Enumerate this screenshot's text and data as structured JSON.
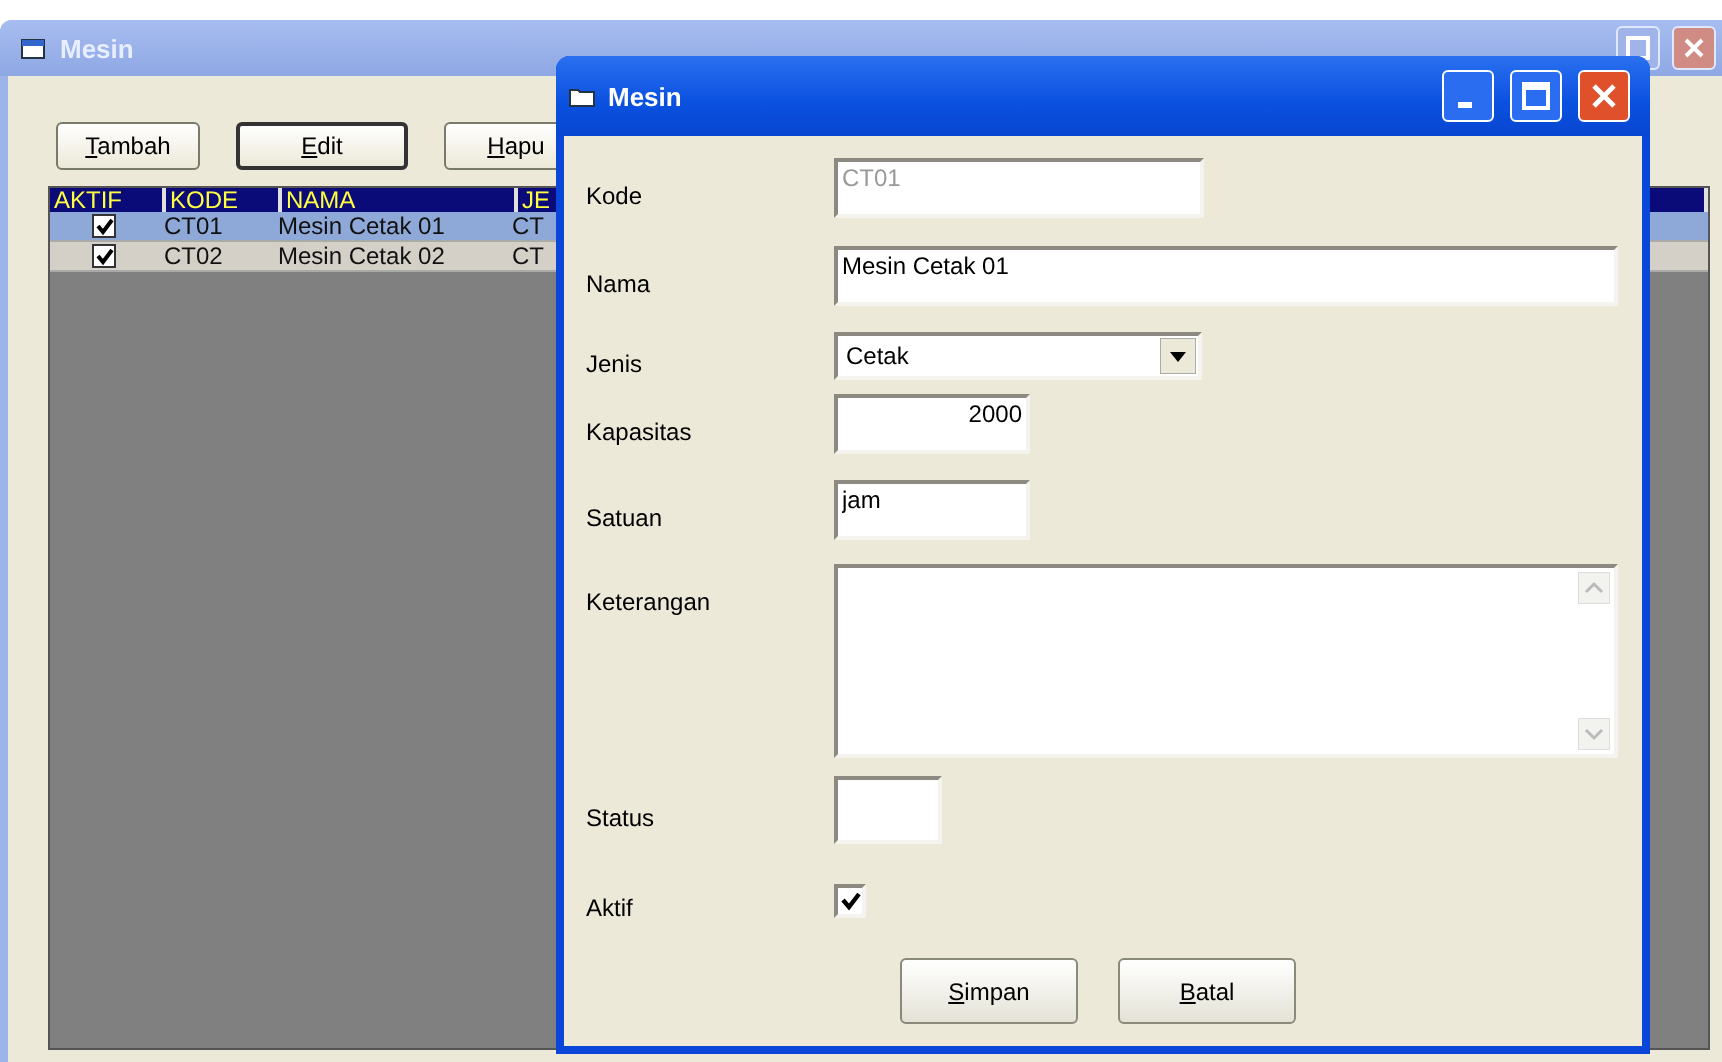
{
  "window": {
    "title": "Mesin"
  },
  "toolbar": [
    {
      "label": "Tambah",
      "default": false
    },
    {
      "label": "Edit",
      "default": true
    },
    {
      "label": "Hapu",
      "default": false
    }
  ],
  "grid": {
    "columns": [
      "AKTIF",
      "KODE",
      "NAMA",
      "JE"
    ],
    "rows": [
      {
        "aktif": true,
        "kode": "CT01",
        "nama": "Mesin Cetak 01",
        "column_4": "CT",
        "selected": true
      },
      {
        "aktif": true,
        "kode": "CT02",
        "nama": "Mesin Cetak 02",
        "column_4": "CT",
        "selected": false
      }
    ]
  },
  "dialog": {
    "title": "Mesin",
    "fields": [
      {
        "kind": "text",
        "label": "Kode",
        "value": "CT01",
        "disabled": true
      },
      {
        "kind": "long",
        "label": "Nama",
        "value": "Mesin Cetak 01",
        "disabled": false
      },
      {
        "kind": "combo",
        "label": "Jenis",
        "value": "Cetak"
      },
      {
        "kind": "number",
        "label": "Kapasitas",
        "value": "2000"
      },
      {
        "kind": "short",
        "label": "Satuan",
        "value": "jam",
        "disabled": false
      },
      {
        "kind": "memo",
        "label": "Keterangan"
      },
      {
        "kind": "tiny",
        "label": "Status"
      },
      {
        "kind": "check",
        "label": "Aktif",
        "checked": true
      }
    ],
    "buttons": [
      "Simpan",
      "Batal"
    ]
  }
}
